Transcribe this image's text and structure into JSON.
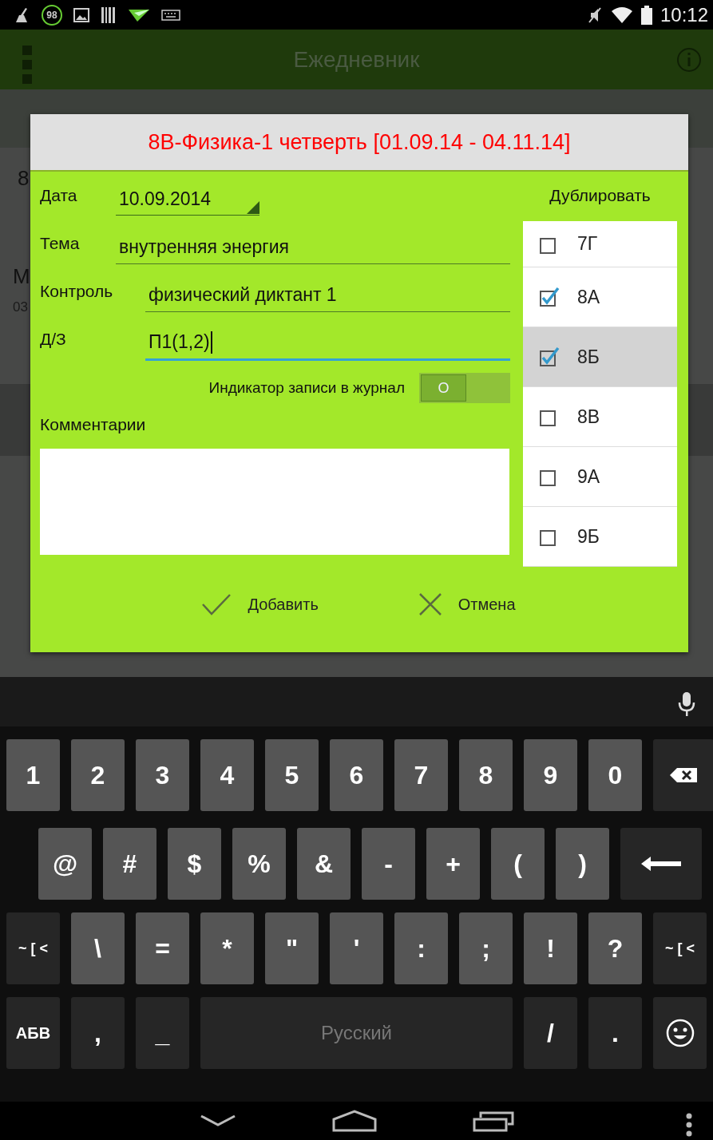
{
  "status_bar": {
    "battery_badge": "98",
    "time": "10:12"
  },
  "app_bar": {
    "title": "Ежедневник"
  },
  "background": {
    "field_text": "8",
    "item_title": "М",
    "item_date": "03"
  },
  "dialog": {
    "title": "8В-Физика-1 четверть [01.09.14 - 04.11.14]",
    "fields": [
      {
        "kind": "spinner",
        "label": "Дата",
        "value": "10.09.2014",
        "focused": false
      },
      {
        "kind": "text",
        "label": "Тема",
        "value": "внутренняя энергия",
        "focused": false
      },
      {
        "kind": "text",
        "label": "Контроль",
        "value": "физический диктант 1",
        "focused": false
      },
      {
        "kind": "text",
        "label": "Д/З",
        "value": "П1(1,2)",
        "focused": true
      }
    ],
    "journal_switch": {
      "label": "Индикатор записи в журнал",
      "on": false,
      "thumb_text": "O"
    },
    "comment": {
      "label": "Комментарии"
    },
    "duplicate": {
      "title": "Дублировать",
      "classes": [
        {
          "label": "7Г",
          "checked": false,
          "selected": false
        },
        {
          "label": "8А",
          "checked": true,
          "selected": false
        },
        {
          "label": "8Б",
          "checked": true,
          "selected": true
        },
        {
          "label": "8В",
          "checked": false,
          "selected": false
        },
        {
          "label": "9А",
          "checked": false,
          "selected": false
        },
        {
          "label": "9Б",
          "checked": false,
          "selected": false
        }
      ]
    },
    "buttons": [
      {
        "kind": "confirm",
        "label": "Добавить"
      },
      {
        "kind": "cancel",
        "label": "Отмена"
      }
    ]
  },
  "keyboard": {
    "rows": [
      [
        {
          "label": "1",
          "kind": "key"
        },
        {
          "label": "2",
          "kind": "key"
        },
        {
          "label": "3",
          "kind": "key"
        },
        {
          "label": "4",
          "kind": "key"
        },
        {
          "label": "5",
          "kind": "key"
        },
        {
          "label": "6",
          "kind": "key"
        },
        {
          "label": "7",
          "kind": "key"
        },
        {
          "label": "8",
          "kind": "key"
        },
        {
          "label": "9",
          "kind": "key"
        },
        {
          "label": "0",
          "kind": "key"
        },
        {
          "kind": "backspace"
        }
      ],
      [
        {
          "label": "@",
          "kind": "key"
        },
        {
          "label": "#",
          "kind": "key"
        },
        {
          "label": "$",
          "kind": "key"
        },
        {
          "label": "%",
          "kind": "key"
        },
        {
          "label": "&",
          "kind": "key"
        },
        {
          "label": "-",
          "kind": "key"
        },
        {
          "label": "+",
          "kind": "key"
        },
        {
          "label": "(",
          "kind": "key"
        },
        {
          "label": ")",
          "kind": "key"
        },
        {
          "kind": "enter"
        }
      ],
      [
        {
          "label": "~ [ <",
          "kind": "mod"
        },
        {
          "label": "\\",
          "kind": "key"
        },
        {
          "label": "=",
          "kind": "key"
        },
        {
          "label": "*",
          "kind": "key"
        },
        {
          "label": "\"",
          "kind": "key"
        },
        {
          "label": "'",
          "kind": "key"
        },
        {
          "label": ":",
          "kind": "key"
        },
        {
          "label": ";",
          "kind": "key"
        },
        {
          "label": "!",
          "kind": "key"
        },
        {
          "label": "?",
          "kind": "key"
        },
        {
          "label": "~ [ <",
          "kind": "mod"
        }
      ]
    ],
    "bottom_row": {
      "left_keys": [
        {
          "label": "АБВ",
          "kind": "mod"
        },
        {
          "label": ",",
          "kind": "dark"
        },
        {
          "label": "_",
          "kind": "dark"
        }
      ],
      "space_bar": "Русский",
      "right_keys": [
        {
          "label": "/",
          "kind": "dark"
        },
        {
          "label": ".",
          "kind": "dark"
        },
        {
          "kind": "emoji"
        }
      ]
    }
  }
}
